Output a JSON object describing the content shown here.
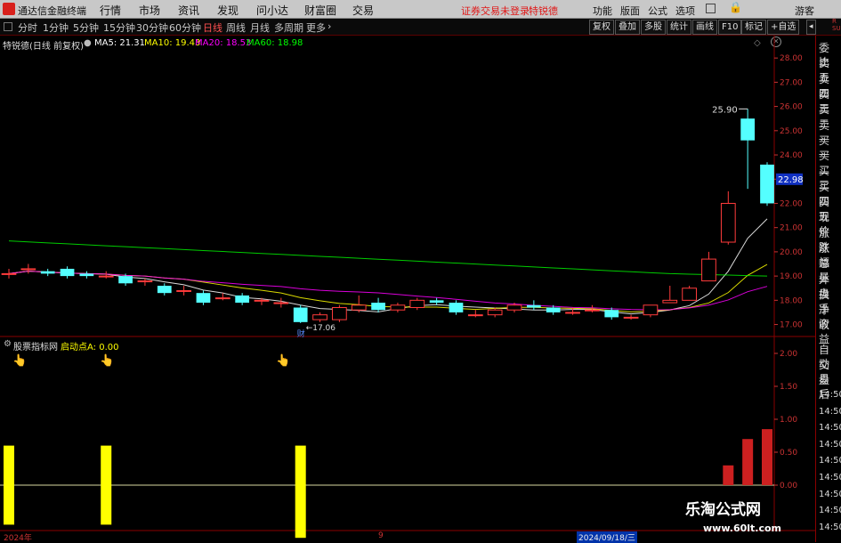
{
  "menubar": {
    "app_title": "通达信金融终端",
    "items": [
      "行情",
      "市场",
      "资讯",
      "发现",
      "问小达",
      "财富圈",
      "交易"
    ],
    "warning": "证券交易未登录",
    "stock_name": "特锐德",
    "right_items": [
      "功能",
      "版面",
      "公式",
      "选项"
    ],
    "guest": "游客",
    "colors": {
      "bar_bg": "#c8c8c8",
      "warning": "#e01818"
    }
  },
  "period_tabs": [
    "分时",
    "1分钟",
    "5分钟",
    "15分钟",
    "30分钟",
    "60分钟",
    "日线",
    "周线",
    "月线",
    "多周期",
    "更多"
  ],
  "active_tab": "日线",
  "toolbar_buttons": [
    "复权",
    "叠加",
    "多股",
    "统计",
    "画线",
    "F10",
    "标记",
    "+自选"
  ],
  "chart_info": {
    "stock": "特锐德(日线 前复权)",
    "ma5": "MA5: 21.31",
    "ma10": "MA10: 19.43",
    "ma20": "MA20: 18.53",
    "ma60": "MA60: 18.98",
    "colors": {
      "ma5": "#ffffff",
      "ma10": "#ffff00",
      "ma20": "#ff00ff",
      "ma60": "#00ff00"
    }
  },
  "indicator_info": {
    "name": "股票指标网",
    "param": "启动点A: 0.00"
  },
  "chart_data": {
    "type": "candlestick",
    "price_axis": {
      "ticks": [
        "28.00",
        "27.00",
        "26.00",
        "25.00",
        "24.00",
        "23.00",
        "22.00",
        "21.00",
        "20.00",
        "19.00",
        "18.00",
        "17.00"
      ],
      "min": 16.8,
      "max": 28.3
    },
    "current_price_label": "22.98",
    "max_label": "25.90",
    "min_label": "17.06",
    "event_marker": "财",
    "indicator_axis": {
      "ticks": [
        "2.00",
        "1.50",
        "1.00",
        "0.50",
        "0.00"
      ],
      "min": -1.1,
      "max": 2.2
    },
    "x_labels": [
      "2024年",
      "9",
      "2024/09/18/三"
    ],
    "candles": [
      {
        "o": 19.1,
        "c": 19.1,
        "h": 19.3,
        "l": 18.9
      },
      {
        "o": 19.3,
        "c": 19.3,
        "h": 19.5,
        "l": 19.1
      },
      {
        "o": 19.2,
        "c": 19.1,
        "h": 19.3,
        "l": 19.0
      },
      {
        "o": 19.3,
        "c": 19.0,
        "h": 19.4,
        "l": 18.9
      },
      {
        "o": 19.1,
        "c": 19.0,
        "h": 19.2,
        "l": 18.9
      },
      {
        "o": 19.0,
        "c": 19.0,
        "h": 19.2,
        "l": 18.9
      },
      {
        "o": 19.0,
        "c": 18.7,
        "h": 19.1,
        "l": 18.6
      },
      {
        "o": 18.8,
        "c": 18.8,
        "h": 18.9,
        "l": 18.6
      },
      {
        "o": 18.6,
        "c": 18.3,
        "h": 18.7,
        "l": 18.2
      },
      {
        "o": 18.4,
        "c": 18.4,
        "h": 18.6,
        "l": 18.2
      },
      {
        "o": 18.3,
        "c": 17.9,
        "h": 18.4,
        "l": 17.8
      },
      {
        "o": 18.1,
        "c": 18.1,
        "h": 18.3,
        "l": 18.0
      },
      {
        "o": 18.2,
        "c": 17.9,
        "h": 18.3,
        "l": 17.8
      },
      {
        "o": 18.0,
        "c": 18.0,
        "h": 18.1,
        "l": 17.8
      },
      {
        "o": 17.9,
        "c": 17.9,
        "h": 18.1,
        "l": 17.7
      },
      {
        "o": 17.7,
        "c": 17.1,
        "h": 17.8,
        "l": 17.06
      },
      {
        "o": 17.2,
        "c": 17.4,
        "h": 17.5,
        "l": 17.1
      },
      {
        "o": 17.2,
        "c": 17.7,
        "h": 17.8,
        "l": 17.1
      },
      {
        "o": 17.6,
        "c": 17.8,
        "h": 18.2,
        "l": 17.5
      },
      {
        "o": 17.9,
        "c": 17.6,
        "h": 18.1,
        "l": 17.5
      },
      {
        "o": 17.6,
        "c": 17.8,
        "h": 17.9,
        "l": 17.5
      },
      {
        "o": 17.7,
        "c": 18.0,
        "h": 18.1,
        "l": 17.6
      },
      {
        "o": 18.0,
        "c": 17.9,
        "h": 18.1,
        "l": 17.8
      },
      {
        "o": 17.9,
        "c": 17.5,
        "h": 18.0,
        "l": 17.4
      },
      {
        "o": 17.4,
        "c": 17.4,
        "h": 17.6,
        "l": 17.3
      },
      {
        "o": 17.4,
        "c": 17.6,
        "h": 17.7,
        "l": 17.3
      },
      {
        "o": 17.6,
        "c": 17.8,
        "h": 17.9,
        "l": 17.5
      },
      {
        "o": 17.8,
        "c": 17.7,
        "h": 18.0,
        "l": 17.6
      },
      {
        "o": 17.7,
        "c": 17.5,
        "h": 17.8,
        "l": 17.4
      },
      {
        "o": 17.5,
        "c": 17.5,
        "h": 17.7,
        "l": 17.4
      },
      {
        "o": 17.6,
        "c": 17.6,
        "h": 17.8,
        "l": 17.5
      },
      {
        "o": 17.6,
        "c": 17.3,
        "h": 17.7,
        "l": 17.2
      },
      {
        "o": 17.3,
        "c": 17.3,
        "h": 17.4,
        "l": 17.2
      },
      {
        "o": 17.4,
        "c": 17.8,
        "h": 17.8,
        "l": 17.3
      },
      {
        "o": 17.9,
        "c": 18.0,
        "h": 18.6,
        "l": 17.9
      },
      {
        "o": 18.0,
        "c": 18.5,
        "h": 18.6,
        "l": 18.0
      },
      {
        "o": 18.8,
        "c": 19.7,
        "h": 20.0,
        "l": 18.8
      },
      {
        "o": 20.4,
        "c": 22.0,
        "h": 22.5,
        "l": 20.3
      },
      {
        "o": 25.5,
        "c": 24.6,
        "h": 25.9,
        "l": 22.6
      },
      {
        "o": 23.6,
        "c": 22.0,
        "h": 23.7,
        "l": 21.9
      }
    ],
    "indicator_bars": [
      {
        "i": 0,
        "v": 0.6,
        "color": "#ffff00",
        "neg": 0.6
      },
      {
        "i": 5,
        "v": 0.6,
        "color": "#ffff00",
        "neg": 0.6
      },
      {
        "i": 15,
        "v": 0.6,
        "color": "#ffff00",
        "neg": 0.8
      },
      {
        "i": 37,
        "v": 0.3,
        "color": "#cc2020"
      },
      {
        "i": 38,
        "v": 0.7,
        "color": "#cc2020"
      },
      {
        "i": 39,
        "v": 0.85,
        "color": "#cc2020"
      }
    ]
  },
  "right_panel_top": [
    "R",
    "SU"
  ],
  "right_panel": [
    "委比",
    "卖五",
    "卖四",
    "卖三",
    "卖二",
    "卖一",
    "买一",
    "买二",
    "买三",
    "买四",
    "买五",
    "现价",
    "涨跌",
    "涨幅",
    "总量",
    "外盘",
    "换手",
    "净资",
    "收益"
  ],
  "right_panel_bottom": [
    "自动",
    "交易",
    "盘后",
    "14:50",
    "14:50",
    "14:50",
    "14:50",
    "14:50",
    "14:50",
    "14:50",
    "14:50",
    "14:50"
  ],
  "watermark": {
    "line1": "乐淘公式网",
    "line2": "www.60lt.com"
  }
}
